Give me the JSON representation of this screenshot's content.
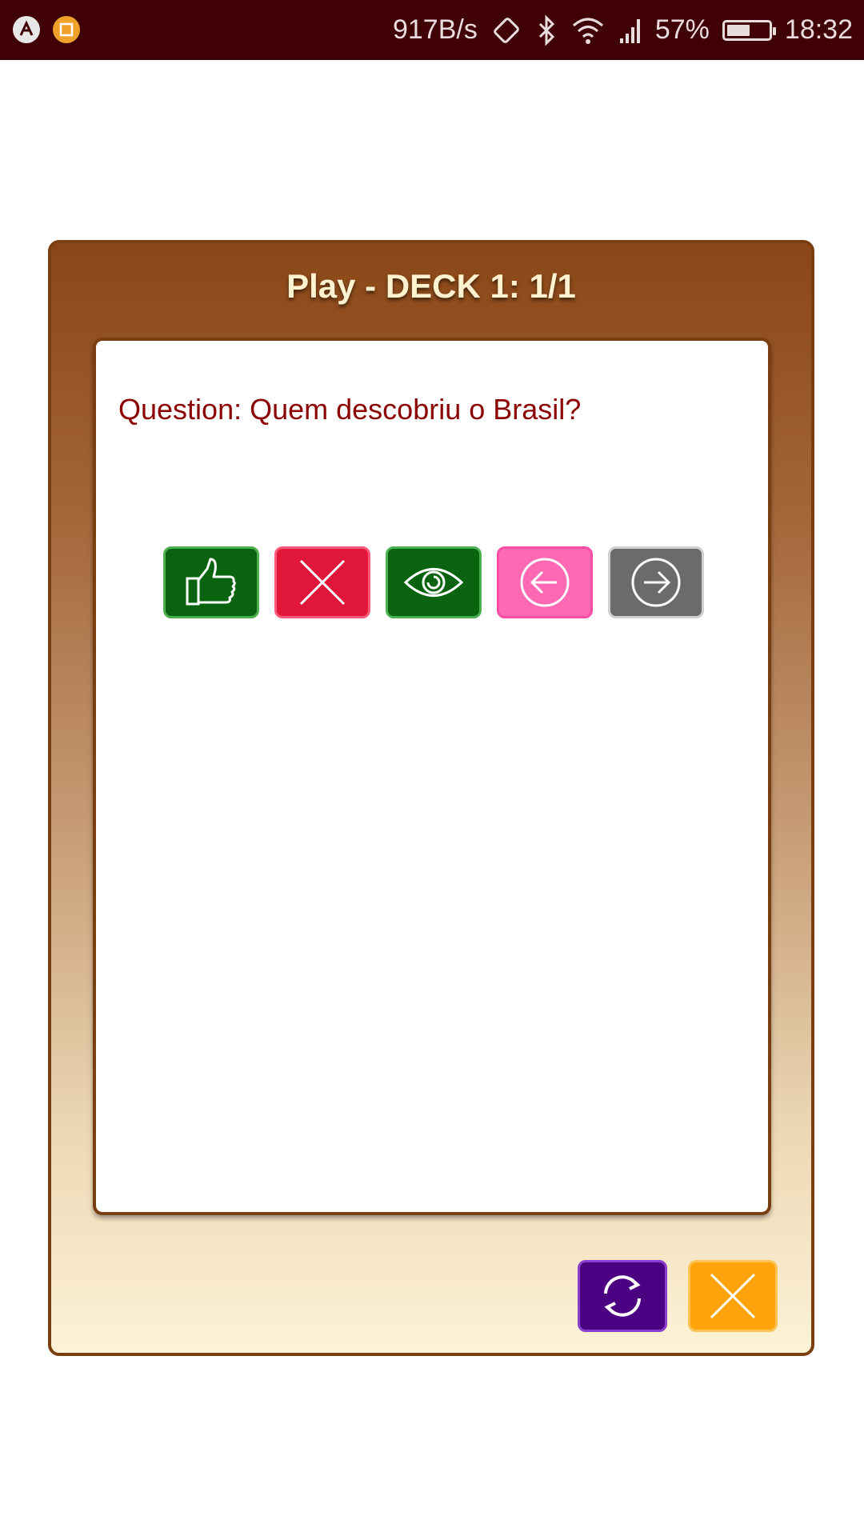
{
  "status_bar": {
    "network_speed": "917B/s",
    "battery_percent": "57%",
    "battery_level": 0.57,
    "time": "18:32",
    "icons": [
      "app-notification-icon",
      "app-notification-icon",
      "rotation-lock-icon",
      "bluetooth-icon",
      "wifi-icon",
      "signal-icon",
      "battery-icon"
    ]
  },
  "dialog": {
    "title": "Play - DECK 1: 1/1",
    "question": "Question: Quem descobriu o Brasil?",
    "actions": [
      {
        "name": "correct-button",
        "icon": "thumbs-up-icon",
        "color": "#0a640f"
      },
      {
        "name": "wrong-button",
        "icon": "close-icon",
        "color": "#e0163b"
      },
      {
        "name": "show-answer-button",
        "icon": "eye-icon",
        "color": "#0a640f"
      },
      {
        "name": "previous-button",
        "icon": "arrow-left-circle-icon",
        "color": "#ff69b4"
      },
      {
        "name": "next-button",
        "icon": "arrow-right-circle-icon",
        "color": "#6b6b6b"
      }
    ],
    "footer": [
      {
        "name": "restart-button",
        "icon": "refresh-icon",
        "color": "#4b0082"
      },
      {
        "name": "close-dialog-button",
        "icon": "close-icon",
        "color": "#ffa40c"
      }
    ]
  }
}
